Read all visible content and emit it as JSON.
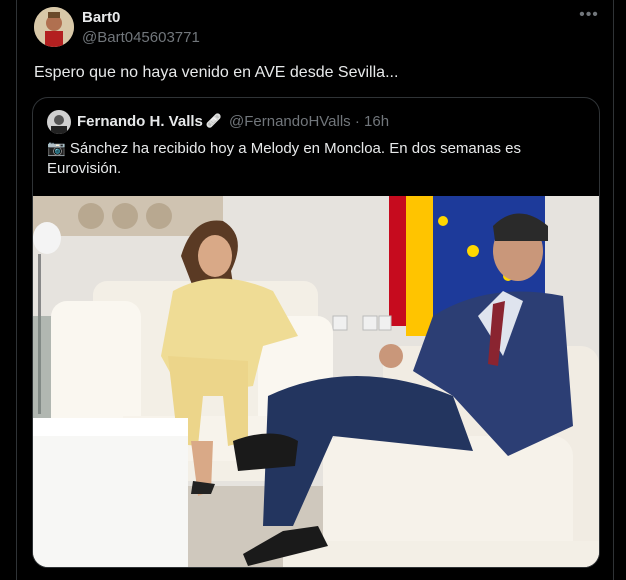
{
  "tweet": {
    "author_name": "Bart0",
    "author_handle": "@Bart045603771",
    "more_icon": "more-icon",
    "more_glyph": "•••",
    "text": "Espero que no haya venido en AVE desde Sevilla..."
  },
  "quote": {
    "author_name": "Fernando H. Valls",
    "badge_icon": "bandage-icon",
    "badge_glyph": "🩹",
    "author_handle": "@FernandoHValls",
    "separator": "·",
    "time": "16h",
    "camera_glyph": "📷",
    "text": "Sánchez ha recibido hoy a Melody en Moncloa. En dos semanas es Eurovisión."
  },
  "colors": {
    "background": "#000000",
    "text": "#e7e9ea",
    "secondary_text": "#71767b",
    "border": "#2f3336"
  }
}
